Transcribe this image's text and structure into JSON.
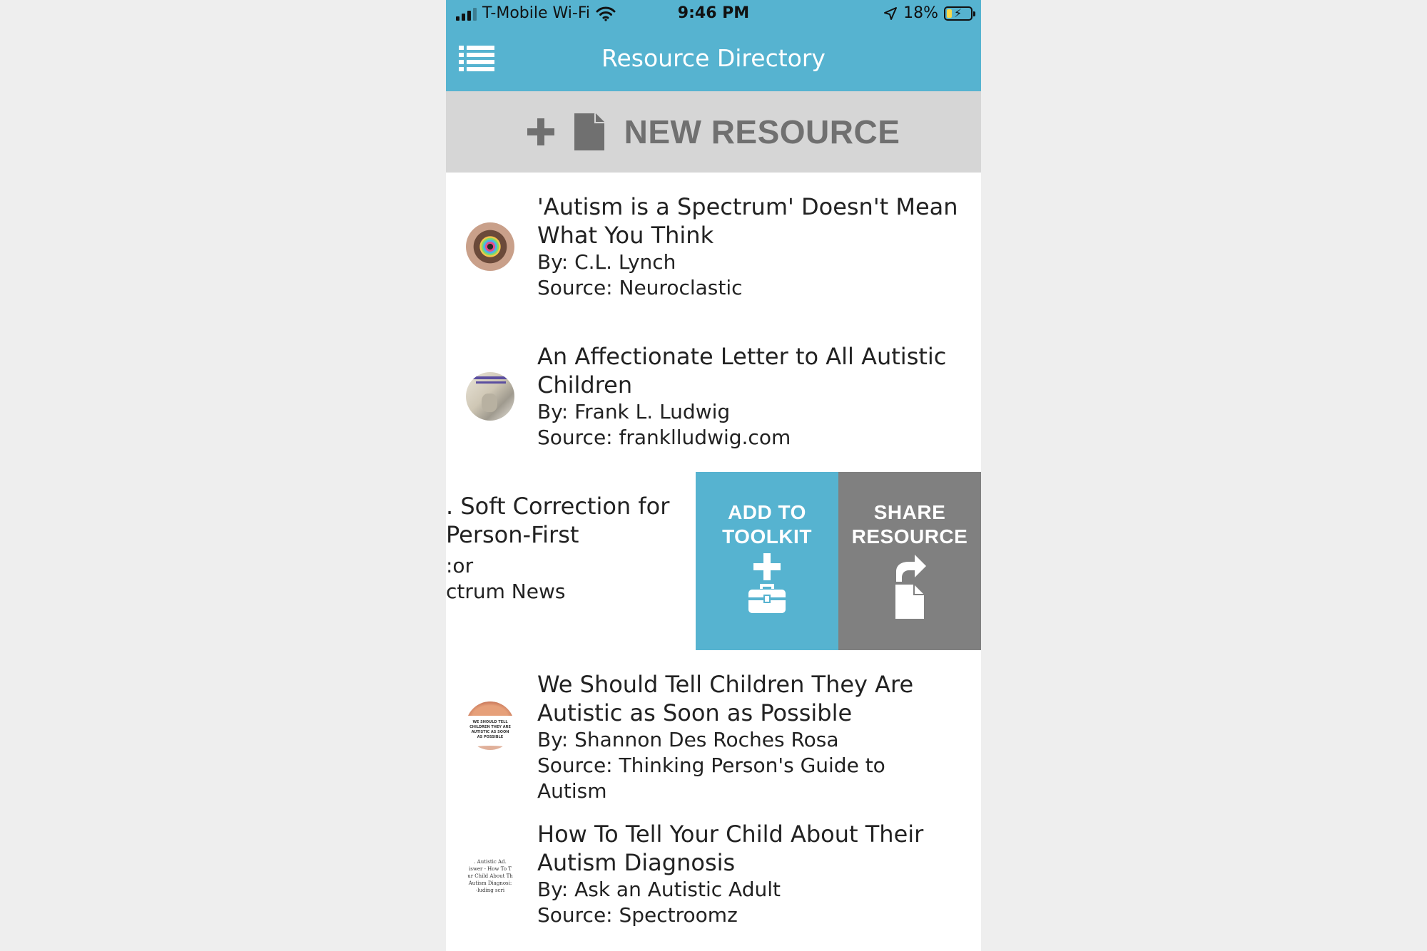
{
  "status_bar": {
    "carrier": "T-Mobile Wi-Fi",
    "time": "9:46 PM",
    "battery": "18%"
  },
  "header": {
    "title": "Resource Directory"
  },
  "new_resource": {
    "label": "NEW RESOURCE"
  },
  "resources": [
    {
      "title_line1": "'Autism is a Spectrum' Doesn't Mean",
      "title_line2": "What You Think",
      "author": "By: C.L. Lynch",
      "source": "Source: Neuroclastic"
    },
    {
      "title_line1": "An Affectionate Letter to All Autistic",
      "title_line2": "Children",
      "author": "By: Frank L. Ludwig",
      "source": "Source: franklludwig.com"
    },
    {
      "title_line1": ". Soft Correction for",
      "title_line2": "Person-First",
      "author": ":or",
      "source": "ctrum News"
    },
    {
      "title_line1": "We Should Tell Children They Are",
      "title_line2": "Autistic as Soon as Possible",
      "author": "By: Shannon Des Roches Rosa",
      "source": "Source: Thinking Person's Guide to Autism",
      "thumb_text": "WE SHOULD TELL CHILDREN THEY ARE AUTISTIC AS SOON AS POSSIBLE"
    },
    {
      "title_line1": "How To Tell Your Child About Their",
      "title_line2": "Autism Diagnosis",
      "author": "By: Ask an Autistic Adult",
      "source": "Source: Spectroomz",
      "thumb_text": ". Autistic Ad. iswer - How To T ur Child About Th Autism Diagnosi: -luding scri"
    }
  ],
  "swipe_actions": {
    "add_line1": "ADD TO",
    "add_line2": "TOOLKIT",
    "share_line1": "SHARE",
    "share_line2": "RESOURCE"
  },
  "colors": {
    "accent": "#56b3d0",
    "gray_action": "#808080",
    "new_resource_bg": "#d6d6d6"
  }
}
